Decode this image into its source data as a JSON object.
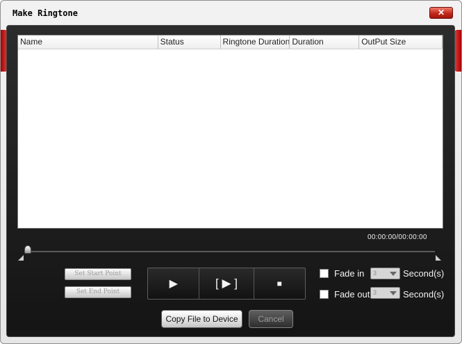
{
  "window": {
    "title": "Make Ringtone",
    "close_glyph": "✕"
  },
  "table": {
    "columns": [
      "Name",
      "Status",
      "Ringtone Duration",
      "Duration",
      "OutPut Size"
    ]
  },
  "player": {
    "time": "00:00:00/00:00:00",
    "position_fraction": 0.0,
    "set_start": "Set Start Point",
    "set_end": "Set End Point",
    "play_icon": "▶",
    "segment_icon": "[ ▶ ]",
    "stop_icon": "■"
  },
  "options": {
    "fade_in": {
      "label": "Fade in",
      "checked": false,
      "value": "3",
      "unit": "Second(s)"
    },
    "fade_out": {
      "label": "Fade out",
      "checked": false,
      "value": "3",
      "unit": "Second(s)"
    }
  },
  "actions": {
    "copy": "Copy File to Device",
    "cancel": "Cancel"
  },
  "colors": {
    "panel": "#1c1c1c",
    "accent": "#c2281a"
  }
}
